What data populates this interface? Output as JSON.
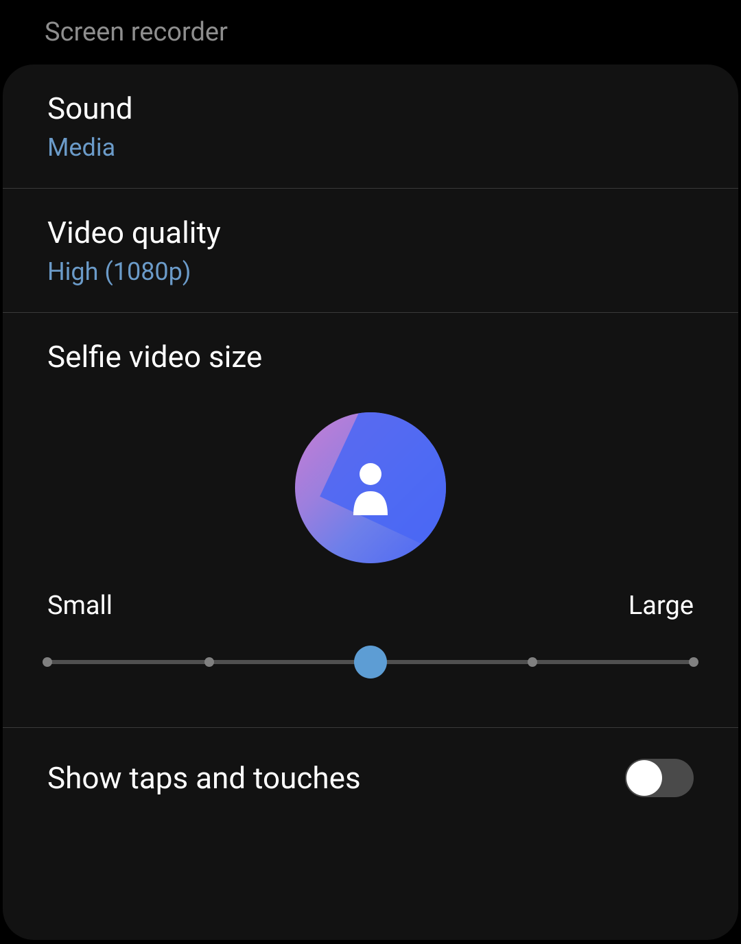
{
  "header": {
    "title": "Screen recorder"
  },
  "settings": {
    "sound": {
      "label": "Sound",
      "value": "Media"
    },
    "videoQuality": {
      "label": "Video quality",
      "value": "High (1080p)"
    },
    "selfieVideoSize": {
      "label": "Selfie video size",
      "slider": {
        "minLabel": "Small",
        "maxLabel": "Large",
        "steps": 5,
        "currentStep": 2
      }
    },
    "showTapsAndTouches": {
      "label": "Show taps and touches",
      "enabled": false
    }
  },
  "colors": {
    "accent": "#6b9bc9",
    "sliderThumb": "#5d9dd4"
  }
}
